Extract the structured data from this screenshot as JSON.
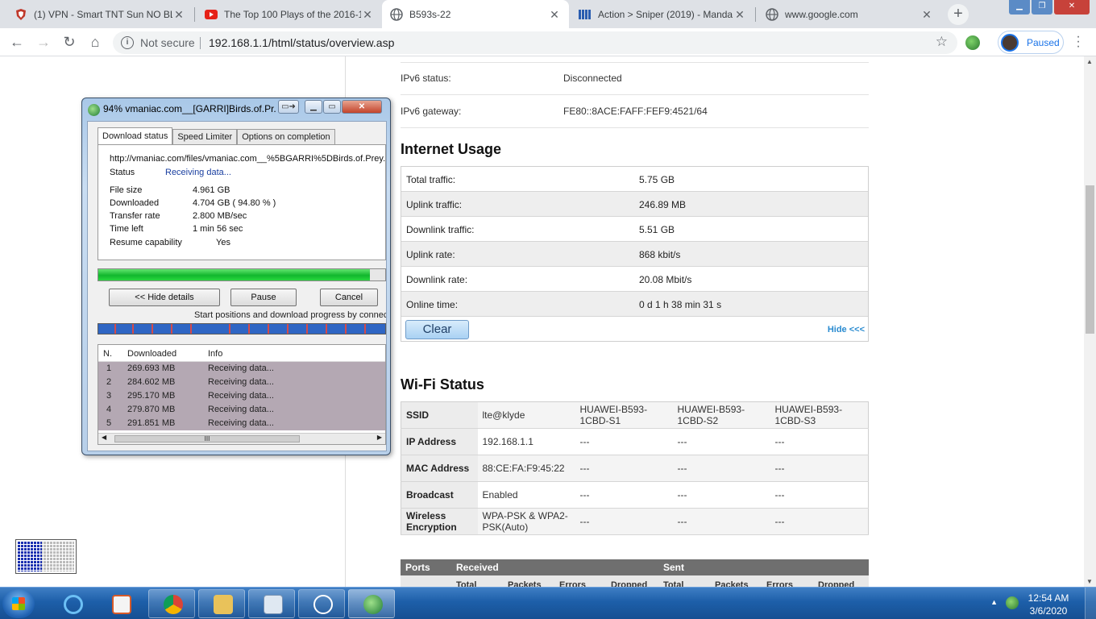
{
  "browser": {
    "tabs": [
      {
        "title": "(1) VPN - Smart TNT Sun NO BL",
        "icon": "shield-icon"
      },
      {
        "title": "The Top 100 Plays of the 2016-1",
        "icon": "youtube-icon"
      },
      {
        "title": "B593s-22",
        "icon": "globe-icon"
      },
      {
        "title": "Action > Sniper (2019) - Manda",
        "icon": "site-icon"
      },
      {
        "title": "www.google.com",
        "icon": "globe-icon"
      }
    ],
    "new_tab": "+",
    "address": {
      "security": "Not secure",
      "url": "192.168.1.1/html/status/overview.asp"
    },
    "profile_label": "Paused"
  },
  "router": {
    "ipv6": [
      {
        "label": "IPv6 status:",
        "value": "Disconnected"
      },
      {
        "label": "IPv6 gateway:",
        "value": "FE80::8ACE:FAFF:FEF9:4521/64"
      }
    ],
    "internet_usage": {
      "title": "Internet Usage",
      "rows": [
        {
          "label": "Total traffic:",
          "value": "5.75 GB"
        },
        {
          "label": "Uplink traffic:",
          "value": "246.89 MB"
        },
        {
          "label": "Downlink traffic:",
          "value": "5.51 GB"
        },
        {
          "label": "Uplink rate:",
          "value": "868 kbit/s"
        },
        {
          "label": "Downlink rate:",
          "value": "20.08 Mbit/s"
        },
        {
          "label": "Online time:",
          "value": "0 d 1 h 38 min 31 s"
        }
      ],
      "clear_label": "Clear",
      "hide_label": "Hide <<<"
    },
    "wifi_status": {
      "title": "Wi-Fi Status",
      "rows": [
        {
          "label": "SSID",
          "cells": [
            "lte@klyde",
            "HUAWEI-B593-1CBD-S1",
            "HUAWEI-B593-1CBD-S2",
            "HUAWEI-B593-1CBD-S3"
          ]
        },
        {
          "label": "IP Address",
          "cells": [
            "192.168.1.1",
            "---",
            "---",
            "---"
          ]
        },
        {
          "label": "MAC Address",
          "cells": [
            "88:CE:FA:F9:45:22",
            "---",
            "---",
            "---"
          ]
        },
        {
          "label": "Broadcast",
          "cells": [
            "Enabled",
            "---",
            "---",
            "---"
          ]
        },
        {
          "label": "Wireless Encryption",
          "cells": [
            "WPA-PSK & WPA2-PSK(Auto)",
            "---",
            "---",
            "---"
          ]
        }
      ]
    },
    "ports": {
      "headers": [
        "Ports",
        "Received",
        "Sent"
      ],
      "subheaders": [
        "Total",
        "Packets",
        "Errors",
        "Dropped",
        "Total",
        "Packets",
        "Errors",
        "Dropped"
      ]
    }
  },
  "idm": {
    "title": "94% vmaniac.com__[GARRI]Birds.of.Pr...",
    "tabs": [
      "Download status",
      "Speed Limiter",
      "Options on completion"
    ],
    "url": "http://vmaniac.com/files/vmaniac.com__%5BGARRI%5DBirds.of.Prey.",
    "status_label": "Status",
    "status_value": "Receiving data...",
    "fields": [
      {
        "label": "File size",
        "value": "4.961  GB"
      },
      {
        "label": "Downloaded",
        "value": "4.704  GB  ( 94.80 % )"
      },
      {
        "label": "Transfer rate",
        "value": "2.800  MB/sec"
      },
      {
        "label": "Time left",
        "value": "1 min 56 sec"
      },
      {
        "label": "Resume capability",
        "value": "Yes"
      }
    ],
    "progress_percent": 94.8,
    "buttons": {
      "hide": "<< Hide details",
      "pause": "Pause",
      "cancel": "Cancel"
    },
    "note": "Start positions and download progress by connections",
    "list_headers": [
      "N.",
      "Downloaded",
      "Info"
    ],
    "connections": [
      {
        "n": "1",
        "downloaded": "269.693  MB",
        "info": "Receiving data..."
      },
      {
        "n": "2",
        "downloaded": "284.602  MB",
        "info": "Receiving data..."
      },
      {
        "n": "3",
        "downloaded": "295.170  MB",
        "info": "Receiving data..."
      },
      {
        "n": "4",
        "downloaded": "279.870  MB",
        "info": "Receiving data..."
      },
      {
        "n": "5",
        "downloaded": "291.851  MB",
        "info": "Receiving data..."
      }
    ],
    "scroll_grip": "III"
  },
  "taskbar": {
    "apps": [
      "internet-explorer-icon",
      "media-player-icon",
      "chrome-icon",
      "file-explorer-icon",
      "notepad-icon",
      "app-icon",
      "idm-icon"
    ],
    "time": "12:54 AM",
    "date": "3/6/2020"
  },
  "colors": {
    "accent": "#1a73e8",
    "progress": "#11b72d",
    "taskbar": "#1d5fa9"
  }
}
